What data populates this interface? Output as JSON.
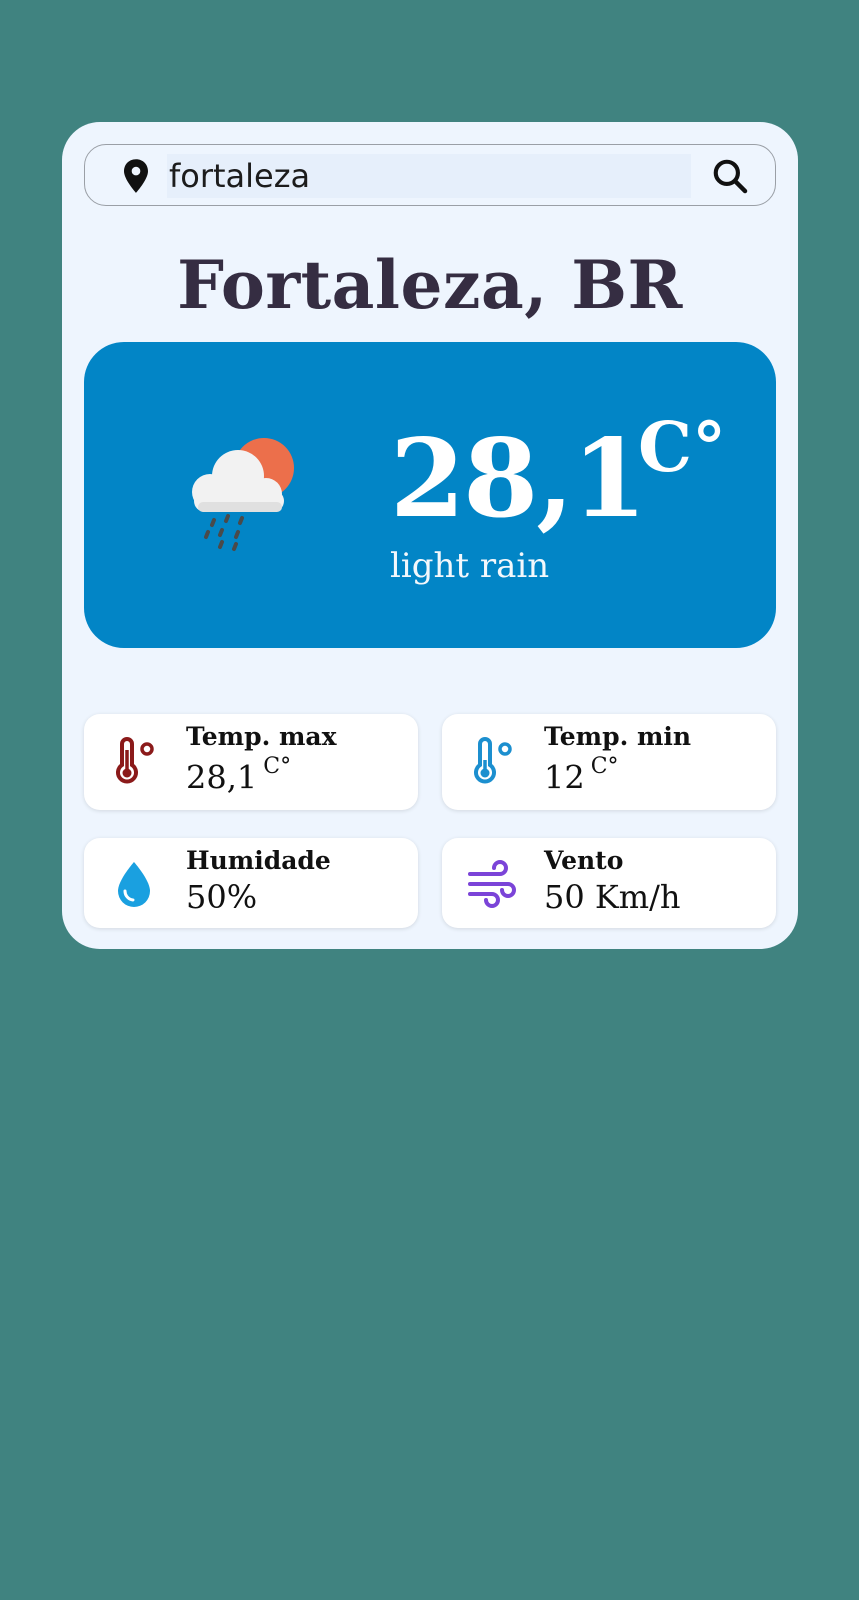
{
  "search": {
    "value": "fortaleza",
    "icon_location": "map-pin-icon",
    "icon_search": "search-icon"
  },
  "city": {
    "title": "Fortaleza, BR"
  },
  "current": {
    "temperature": "28,1",
    "unit": "C°",
    "description": "light rain",
    "icon": "cloud-sun-rain-icon"
  },
  "stats": {
    "temp_max": {
      "label": "Temp. max",
      "value": "28,1",
      "unit": "C°",
      "icon": "thermometer-hot-icon"
    },
    "temp_min": {
      "label": "Temp. min",
      "value": "12",
      "unit": "C°",
      "icon": "thermometer-cold-icon"
    },
    "humidity": {
      "label": "Humidade",
      "value": "50%",
      "icon": "water-drop-icon"
    },
    "wind": {
      "label": "Vento",
      "value": "50 Km/h",
      "icon": "wind-icon"
    }
  },
  "colors": {
    "background": "#408380",
    "card": "#eef5fe",
    "panel": "#0285c6",
    "title": "#352d42",
    "thermometer_hot": "#8b1a1a",
    "thermometer_cold": "#1c8fcf",
    "drop": "#1aa0e0",
    "wind": "#7b44d8"
  }
}
